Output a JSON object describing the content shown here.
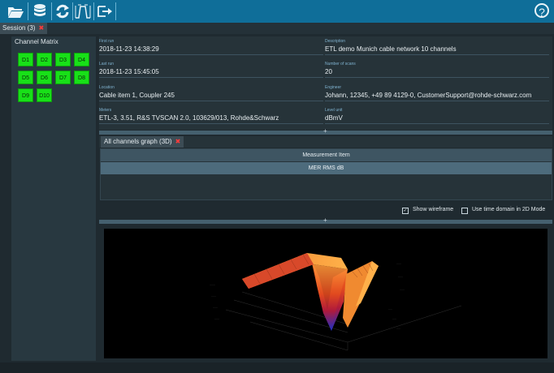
{
  "toolbar": {
    "buttons": [
      {
        "icon": "folder-open-icon"
      },
      {
        "icon": "database-icon"
      },
      {
        "icon": "sync-icon"
      },
      {
        "icon": "spectrum-mask-icon"
      },
      {
        "icon": "export-icon"
      }
    ],
    "help_icon": "help-icon",
    "help_text": "?"
  },
  "tabs": {
    "session_label": "Session (3)",
    "close": "✖"
  },
  "channel_matrix": {
    "title": "Channel Matrix",
    "channels": [
      "D1",
      "D2",
      "D3",
      "D4",
      "D5",
      "D6",
      "D7",
      "D8",
      "D9",
      "D10"
    ]
  },
  "info": {
    "first_run": {
      "label": "First run",
      "value": "2018-11-23 14:38:29"
    },
    "description": {
      "label": "Description",
      "value": "ETL demo Munich cable network 10 channels"
    },
    "last_run": {
      "label": "Last run",
      "value": "2018-11-23 15:45:05"
    },
    "number_of_scans": {
      "label": "Number of scans",
      "value": "20"
    },
    "location": {
      "label": "Location",
      "value": "Cable item 1, Coupler 245"
    },
    "engineer": {
      "label": "Engineer",
      "value": "Johann, 12345, +49 89 4129-0, CustomerSupport@rohde-schwarz.com"
    },
    "meters": {
      "label": "Meters",
      "value": "ETL-3, 3.51, R&S TVSCAN 2.0, 103629/013, Rohde&Schwarz"
    },
    "level_unit": {
      "label": "Level unit",
      "value": "dBmV"
    }
  },
  "splitter_symbol": "+",
  "graph": {
    "tab_label": "All channels graph (3D)",
    "close": "✖",
    "table_header": "Measurement Item",
    "table_row": "MER RMS dB",
    "show_wireframe": {
      "label": "Show wireframe",
      "checked": true
    },
    "time_domain": {
      "label": "Use time domain in 2D Mode",
      "checked": false
    }
  },
  "colors": {
    "toolbar": "#0f6e99",
    "channel_ok": "#18e018",
    "close_x": "#ff3b3b"
  }
}
